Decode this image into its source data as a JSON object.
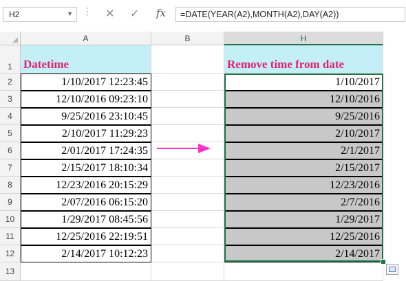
{
  "formula_bar": {
    "name_box": "H2",
    "name_box_arrow": "▼",
    "dots": "⋮",
    "cancel": "✕",
    "enter": "✓",
    "fx": "fx",
    "formula": "=DATE(YEAR(A2),MONTH(A2),DAY(A2))"
  },
  "columns": [
    "A",
    "B",
    "H"
  ],
  "rows": [
    "1",
    "2",
    "3",
    "4",
    "5",
    "6",
    "7",
    "8",
    "9",
    "10",
    "11",
    "12",
    "13"
  ],
  "sheet": {
    "a_title": "Datetime",
    "h_title": "Remove time from date",
    "a_values": [
      "1/10/2017 12:23:45",
      "12/10/2016 09:23:10",
      "9/25/2016 23:10:45",
      "2/10/2017 11:29:23",
      "2/01/2017 17:24:35",
      "2/15/2017 18:10:34",
      "12/23/2016 20:15:29",
      "2/07/2016 06:15:20",
      "1/29/2017 08:45:56",
      "12/25/2016 22:19:51",
      "2/14/2017 10:12:23"
    ],
    "h_values": [
      "1/10/2017",
      "12/10/2016",
      "9/25/2016",
      "2/10/2017",
      "2/1/2017",
      "2/15/2017",
      "12/23/2016",
      "2/7/2016",
      "1/29/2017",
      "12/25/2016",
      "2/14/2017"
    ]
  },
  "colors": {
    "title_text": "#e0216f",
    "header_fill": "#c5eff7",
    "result_fill": "#c8c8c8",
    "selection": "#217346",
    "arrow": "#ff33cc"
  }
}
